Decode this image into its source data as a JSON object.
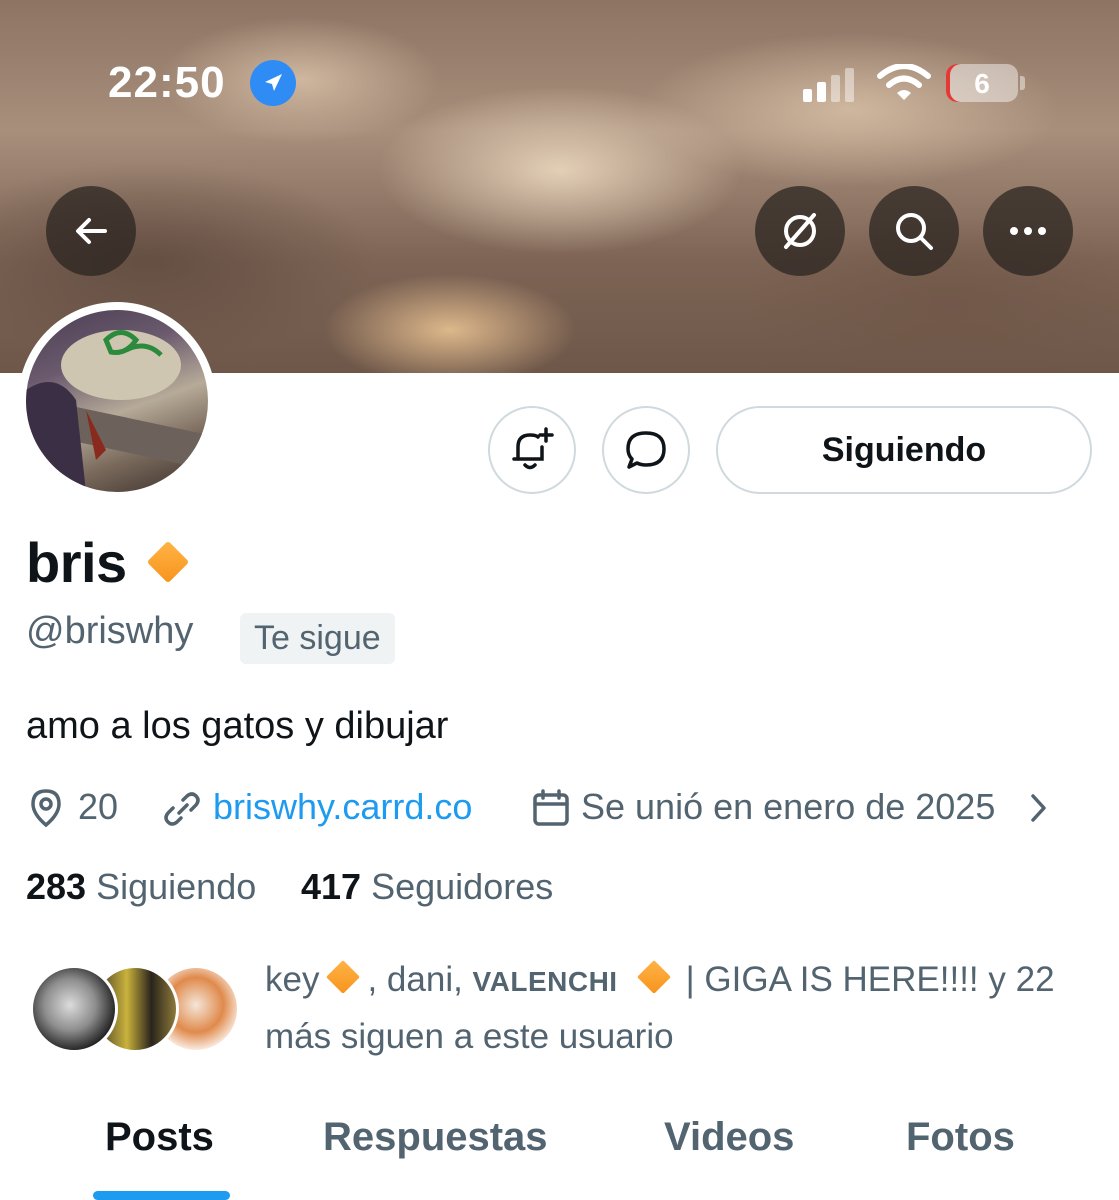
{
  "status_bar": {
    "time": "22:50",
    "battery_level": "6",
    "signal_bars": 2
  },
  "header": {
    "icons": [
      "back-arrow-icon",
      "grok-icon",
      "search-icon",
      "more-icon"
    ]
  },
  "profile": {
    "name": "bris",
    "handle": "@briswhy",
    "follows_you_badge": "Te sigue",
    "bio": "amo a los gatos y dibujar",
    "location": "20",
    "website": "briswhy.carrd.co",
    "joined": "Se unió en enero de 2025",
    "following_count": "283",
    "following_label": "Siguiendo",
    "followers_count": "417",
    "followers_label": "Seguidores",
    "follow_button": "Siguiendo",
    "badge_color": "#f7941d"
  },
  "mutuals": {
    "name1": "key",
    "name2": ", dani, ",
    "name3": "VALENCHI",
    "name4": "| GIGA IS HERE!!!! y 22",
    "suffix": "más siguen a este usuario"
  },
  "tabs": [
    {
      "label": "Posts",
      "active": true
    },
    {
      "label": "Respuestas",
      "active": false
    },
    {
      "label": "Videos",
      "active": false
    },
    {
      "label": "Fotos",
      "active": false
    }
  ],
  "colors": {
    "accent": "#1d9bf0",
    "muted_text": "#536471",
    "primary_text": "#0f1419"
  }
}
